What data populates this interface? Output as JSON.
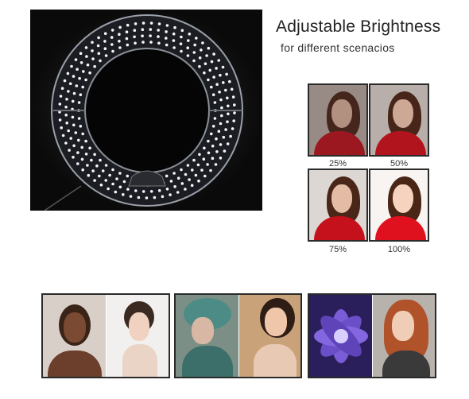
{
  "headline": {
    "title": "Adjustable Brightness",
    "subtitle": "for different scenacios"
  },
  "brightness_samples": [
    {
      "label": "25%",
      "level": 0.25
    },
    {
      "label": "50%",
      "level": 0.5
    },
    {
      "label": "75%",
      "level": 0.75
    },
    {
      "label": "100%",
      "level": 1.0
    }
  ],
  "colors": {
    "panel_bg": "#0a0a0a",
    "led": "#f4f6ff",
    "ring_rim": "#9aa0aa",
    "dress_red": "#d0101c",
    "hair_brown": "#4a2616",
    "skin": "#f2c9b0",
    "sample_border": "#2b2b2b"
  },
  "bottom_groups": [
    {
      "name": "portraits-studio",
      "photos": [
        "woman-posing-hands-on-head",
        "woman-hair-bun-profile"
      ]
    },
    {
      "name": "portraits-scarf",
      "photos": [
        "woman-teal-scarf",
        "woman-warm-light"
      ]
    },
    {
      "name": "flower-and-portrait",
      "photos": [
        "purple-flower-closeup",
        "woman-auburn-hair"
      ]
    }
  ]
}
